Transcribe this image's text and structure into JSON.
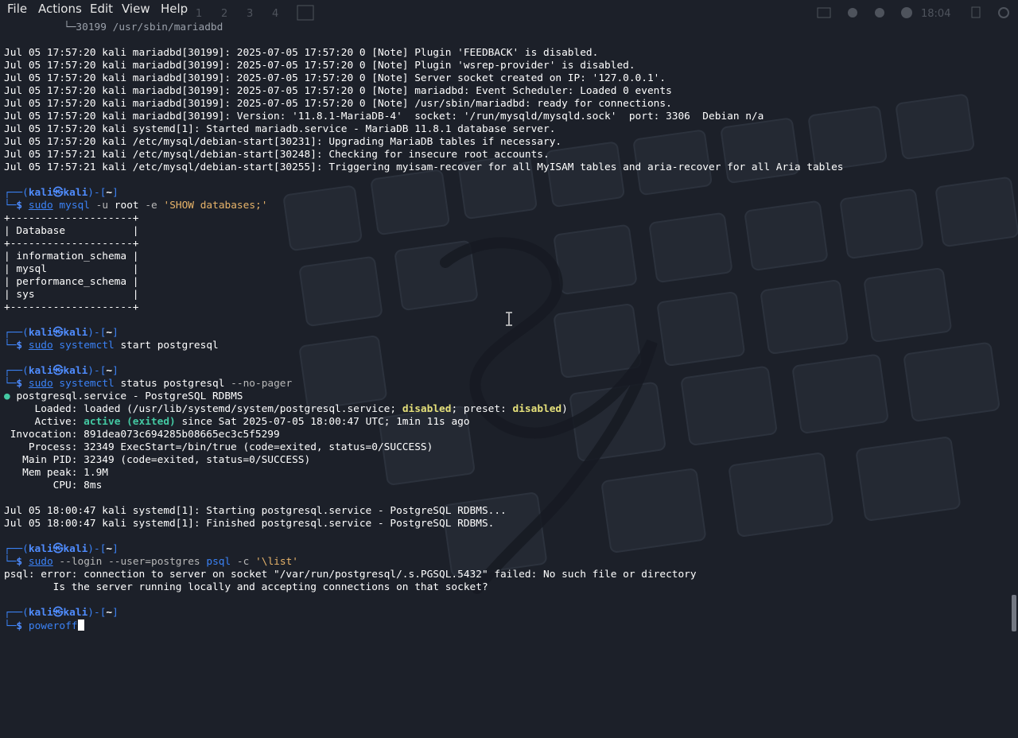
{
  "menubar": {
    "file": "File",
    "actions": "Actions",
    "edit": "Edit",
    "view": "View",
    "help": "Help"
  },
  "panel": {
    "workspaces": [
      "1",
      "2",
      "3",
      "4"
    ],
    "clock": "18:04"
  },
  "prompt": {
    "user": "kali",
    "host": "kali",
    "dir": "~",
    "symbol": "$"
  },
  "lines": {
    "l0": "30199 /usr/sbin/mariadbd",
    "l1": "Jul 05 17:57:20 kali mariadbd[30199]: 2025-07-05 17:57:20 0 [Note] Plugin 'FEEDBACK' is disabled.",
    "l2": "Jul 05 17:57:20 kali mariadbd[30199]: 2025-07-05 17:57:20 0 [Note] Plugin 'wsrep-provider' is disabled.",
    "l3": "Jul 05 17:57:20 kali mariadbd[30199]: 2025-07-05 17:57:20 0 [Note] Server socket created on IP: '127.0.0.1'.",
    "l4": "Jul 05 17:57:20 kali mariadbd[30199]: 2025-07-05 17:57:20 0 [Note] mariadbd: Event Scheduler: Loaded 0 events",
    "l5": "Jul 05 17:57:20 kali mariadbd[30199]: 2025-07-05 17:57:20 0 [Note] /usr/sbin/mariadbd: ready for connections.",
    "l6": "Jul 05 17:57:20 kali mariadbd[30199]: Version: '11.8.1-MariaDB-4'  socket: '/run/mysqld/mysqld.sock'  port: 3306  Debian n/a",
    "l7": "Jul 05 17:57:20 kali systemd[1]: Started mariadb.service - MariaDB 11.8.1 database server.",
    "l8": "Jul 05 17:57:20 kali /etc/mysql/debian-start[30231]: Upgrading MariaDB tables if necessary.",
    "l9": "Jul 05 17:57:21 kali /etc/mysql/debian-start[30248]: Checking for insecure root accounts.",
    "l10": "Jul 05 17:57:21 kali /etc/mysql/debian-start[30255]: Triggering myisam-recover for all MyISAM tables and aria-recover for all Aria tables"
  },
  "cmd1": {
    "sudo": "sudo",
    "prog": "mysql",
    "opt1": "-u",
    "arg1": "root",
    "opt2": "-e",
    "str": "'SHOW databases;'"
  },
  "table": {
    "border": "+--------------------+",
    "header": "| Database           |",
    "rows": [
      "| information_schema |",
      "| mysql              |",
      "| performance_schema |",
      "| sys                |"
    ]
  },
  "cmd2": {
    "sudo": "sudo",
    "prog": "systemctl",
    "rest": "start postgresql"
  },
  "cmd3": {
    "sudo": "sudo",
    "prog": "systemctl",
    "rest": "status postgresql",
    "opt": "--no-pager"
  },
  "status": {
    "dot": "●",
    "unit": "postgresql.service - PostgreSQL RDBMS",
    "loaded_label": "     Loaded: ",
    "loaded_a": "loaded (/usr/lib/systemd/system/postgresql.service; ",
    "loaded_dis": "disabled",
    "loaded_b": "; preset: ",
    "loaded_dis2": "disabled",
    "loaded_c": ")",
    "active_label": "     Active: ",
    "active_state": "active (exited)",
    "active_rest": " since Sat 2025-07-05 18:00:47 UTC; 1min 11s ago",
    "invocation": " Invocation: 891dea073c694285b08665ec3c5f5299",
    "process": "    Process: 32349 ExecStart=/bin/true (code=exited, status=0/SUCCESS)",
    "mainpid": "   Main PID: 32349 (code=exited, status=0/SUCCESS)",
    "mempeak": "   Mem peak: 1.9M",
    "cpu": "        CPU: 8ms",
    "log1": "Jul 05 18:00:47 kali systemd[1]: Starting postgresql.service - PostgreSQL RDBMS...",
    "log2": "Jul 05 18:00:47 kali systemd[1]: Finished postgresql.service - PostgreSQL RDBMS."
  },
  "cmd4": {
    "sudo": "sudo",
    "opt1": "--login",
    "opt2": "--user=postgres",
    "prog": "psql",
    "opt3": "-c",
    "str": "'\\list'"
  },
  "error": {
    "line1": "psql: error: connection to server on socket \"/var/run/postgresql/.s.PGSQL.5432\" failed: No such file or directory",
    "line2": "        Is the server running locally and accepting connections on that socket?"
  },
  "cmd5": {
    "text": "poweroff"
  }
}
